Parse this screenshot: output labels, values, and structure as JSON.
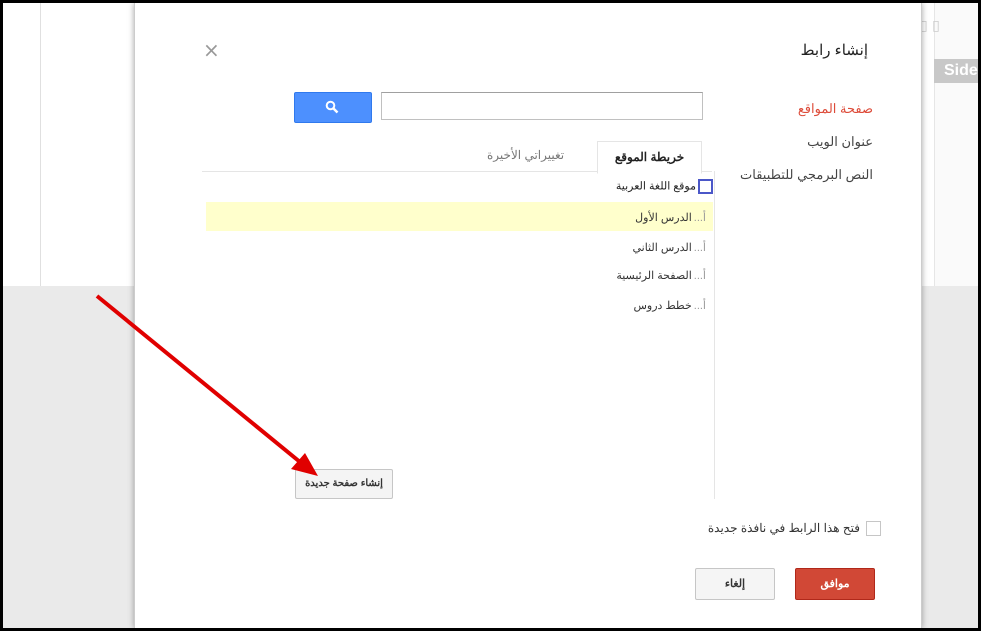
{
  "background": {
    "side_tab_label": "Side"
  },
  "dialog": {
    "title": "إنشاء رابط",
    "close_glyph": "×",
    "side_nav": [
      {
        "label": "صفحة المواقع",
        "active": true
      },
      {
        "label": "عنوان الويب",
        "active": false
      },
      {
        "label": "النص البرمجي للتطبيقات",
        "active": false
      }
    ],
    "search": {
      "value": "",
      "button_icon": "search-icon"
    },
    "tabs": {
      "active": "خريطة الموقع",
      "inactive": "تغييراتي الأخيرة"
    },
    "tree": {
      "root": "موقع اللغة العربية",
      "items": [
        "الدرس الأول",
        "الدرس الثاني",
        "الصفحة الرئيسية",
        "خطط دروس"
      ],
      "lead": "أ..."
    },
    "new_page_button": "إنشاء صفحة جديدة",
    "open_new_window": "فتح هذا الرابط في نافذة جديدة",
    "ok_button": "موافق",
    "cancel_button": "إلغاء"
  },
  "colors": {
    "accent_red": "#dd4b39",
    "search_blue": "#4d90fe",
    "highlight_yellow": "#ffffcc",
    "annotation_arrow": "#e00000"
  }
}
